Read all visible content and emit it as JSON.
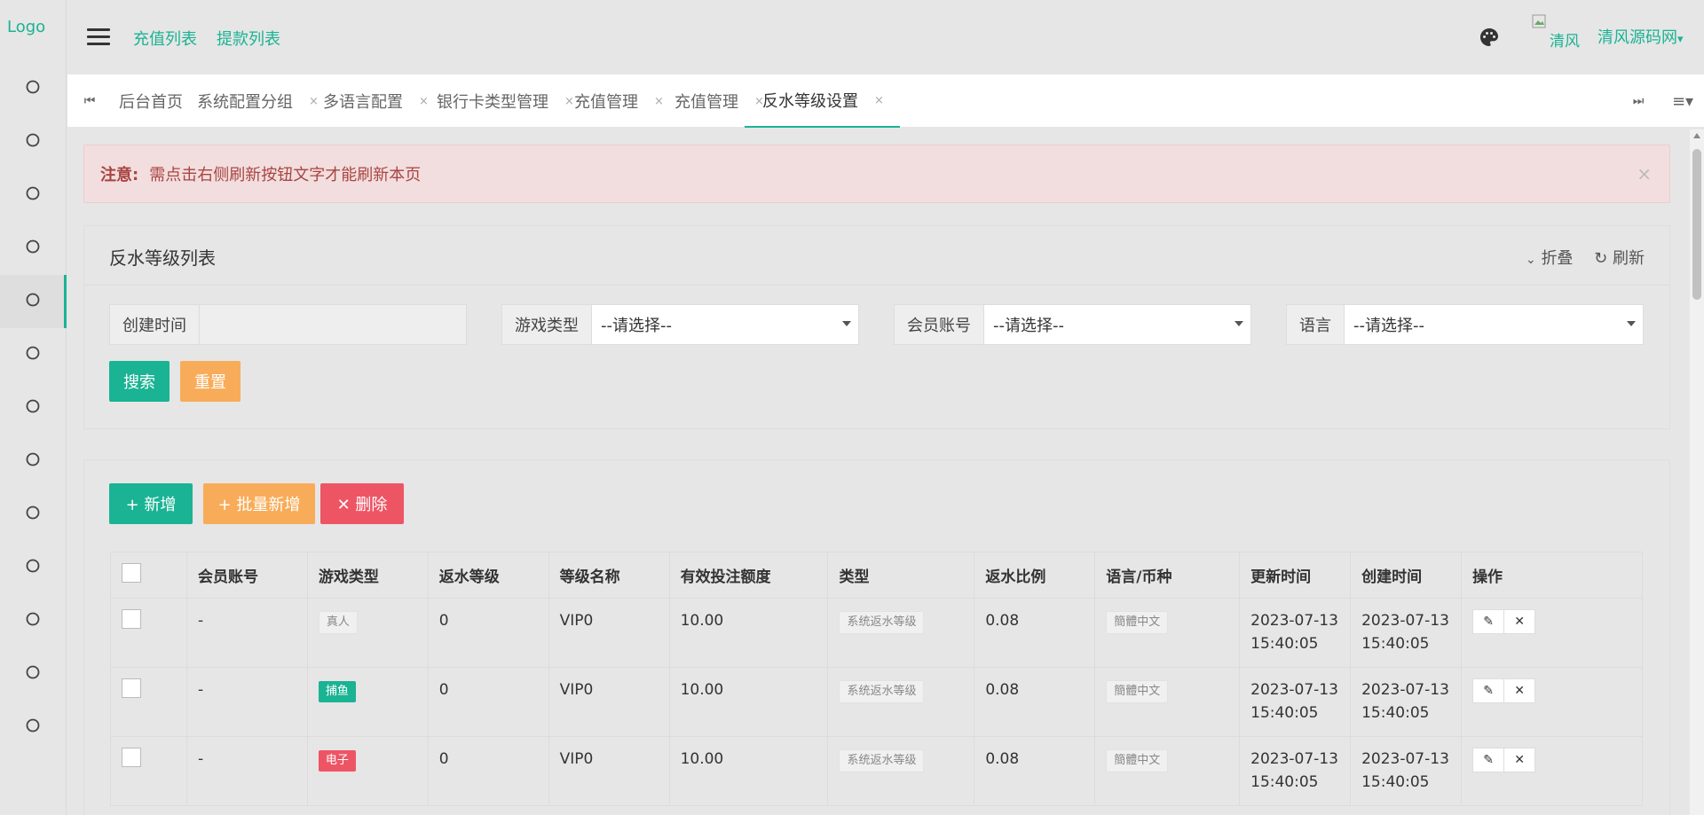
{
  "logo_text": "Logo",
  "sidebar": {
    "items": [
      "",
      "",
      "",
      "",
      "",
      "",
      "",
      "",
      "",
      "",
      "",
      "",
      ""
    ],
    "active_index": 4
  },
  "topbar": {
    "links": [
      "充值列表",
      "提款列表"
    ],
    "avatar_label": "清风",
    "user_name": "清风源码网",
    "user_caret": "▾"
  },
  "tabs": {
    "items": [
      {
        "label": "后台首页",
        "closable": false
      },
      {
        "label": "系统配置分组",
        "closable": true
      },
      {
        "label": "多语言配置",
        "closable": true
      },
      {
        "label": "银行卡类型管理",
        "closable": true
      },
      {
        "label": "充值管理",
        "closable": true
      },
      {
        "label": "充值管理",
        "closable": true
      },
      {
        "label": "反水等级设置",
        "closable": true,
        "active": true
      }
    ],
    "close_char": "×"
  },
  "alert": {
    "title": "注意:",
    "message": "需点击右侧刷新按钮文字才能刷新本页",
    "close": "×"
  },
  "search_panel": {
    "title": "反水等级列表",
    "collapse_label": "折叠",
    "refresh_label": "刷新",
    "fields": {
      "create_time": {
        "label": "创建时间",
        "value": ""
      },
      "game_type": {
        "label": "游戏类型",
        "value": "--请选择--"
      },
      "member": {
        "label": "会员账号",
        "value": "--请选择--"
      },
      "language": {
        "label": "语言",
        "value": "--请选择--"
      }
    },
    "search_btn": "搜索",
    "reset_btn": "重置"
  },
  "toolbar": {
    "add": "+ 新增",
    "batch_add": "+ 批量新增",
    "delete": "✕ 删除"
  },
  "table": {
    "headers": [
      "",
      "会员账号",
      "游戏类型",
      "返水等级",
      "等级名称",
      "有效投注额度",
      "类型",
      "返水比例",
      "语言/币种",
      "更新时间",
      "创建时间",
      "操作"
    ],
    "rows": [
      {
        "member": "-",
        "game_type": "真人",
        "game_color": "grey",
        "level": "0",
        "level_name": "VIP0",
        "bet": "10.00",
        "type": "系统返水等级",
        "ratio": "0.08",
        "lang": "簡體中文",
        "updated": "2023-07-13 15:40:05",
        "created": "2023-07-13 15:40:05"
      },
      {
        "member": "-",
        "game_type": "捕鱼",
        "game_color": "green",
        "level": "0",
        "level_name": "VIP0",
        "bet": "10.00",
        "type": "系统返水等级",
        "ratio": "0.08",
        "lang": "簡體中文",
        "updated": "2023-07-13 15:40:05",
        "created": "2023-07-13 15:40:05"
      },
      {
        "member": "-",
        "game_type": "电子",
        "game_color": "red",
        "level": "0",
        "level_name": "VIP0",
        "bet": "10.00",
        "type": "系统返水等级",
        "ratio": "0.08",
        "lang": "簡體中文",
        "updated": "2023-07-13 15:40:05",
        "created": "2023-07-13 15:40:05"
      }
    ]
  },
  "colors": {
    "accent": "#1ab394",
    "warning": "#f8ac59",
    "danger": "#ed5565",
    "alert_bg": "#f2dede",
    "alert_text": "#a94442"
  }
}
